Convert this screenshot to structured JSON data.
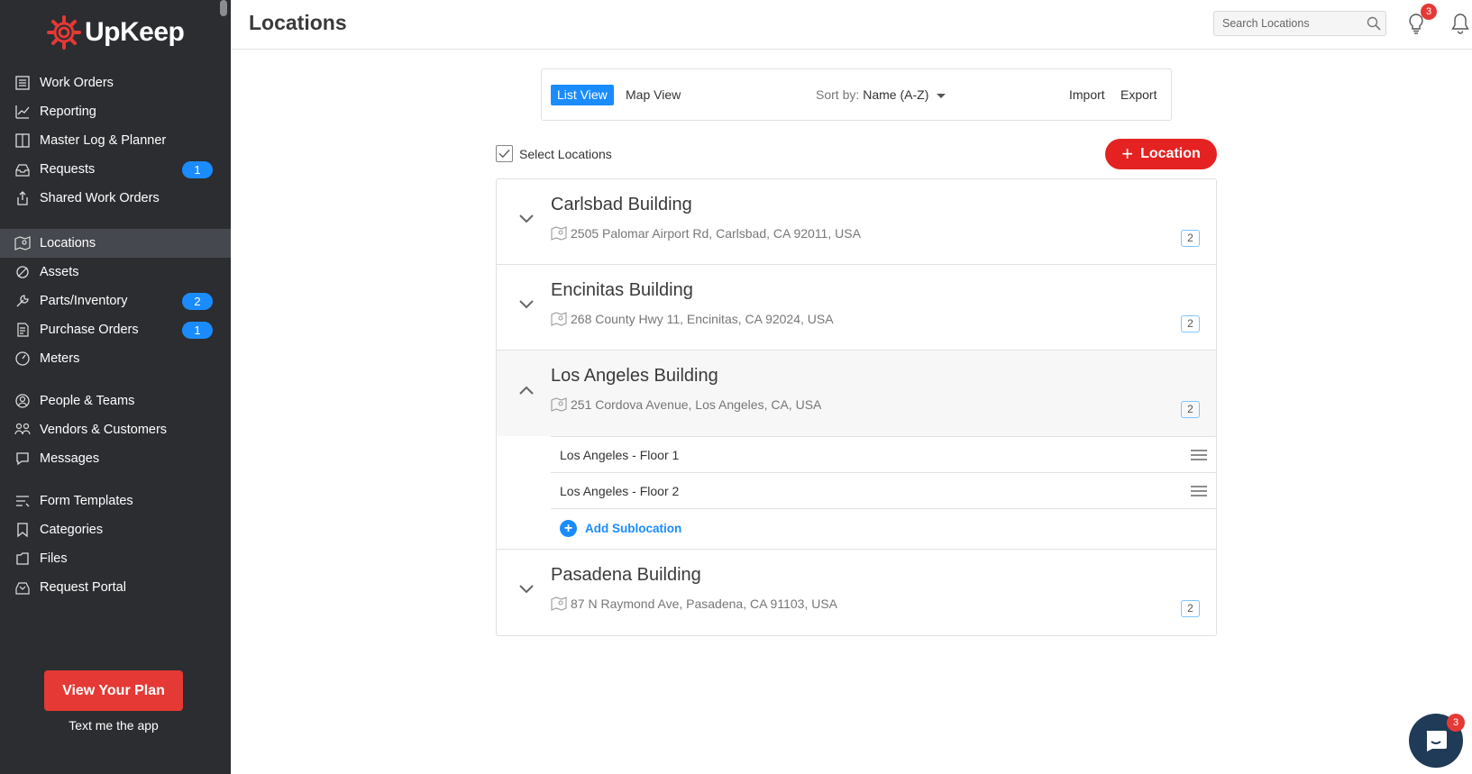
{
  "app": {
    "brand": "UpKeep",
    "accent": "#1a8cff",
    "brand_red": "#e53935"
  },
  "sidebar": {
    "groups": [
      [
        {
          "label": "Work Orders",
          "icon": "list-icon"
        },
        {
          "label": "Reporting",
          "icon": "chart-icon"
        },
        {
          "label": "Master Log & Planner",
          "icon": "book-icon"
        },
        {
          "label": "Requests",
          "icon": "inbox-icon",
          "badge": "1"
        },
        {
          "label": "Shared Work Orders",
          "icon": "share-icon"
        }
      ],
      [
        {
          "label": "Locations",
          "icon": "map-icon",
          "active": true
        },
        {
          "label": "Assets",
          "icon": "asset-icon"
        },
        {
          "label": "Parts/Inventory",
          "icon": "wrench-icon",
          "badge": "2"
        },
        {
          "label": "Purchase Orders",
          "icon": "document-icon",
          "badge": "1"
        },
        {
          "label": "Meters",
          "icon": "gauge-icon"
        }
      ],
      [
        {
          "label": "People & Teams",
          "icon": "people-icon"
        },
        {
          "label": "Vendors & Customers",
          "icon": "vendors-icon"
        },
        {
          "label": "Messages",
          "icon": "chat-bubble-icon"
        }
      ],
      [
        {
          "label": "Form Templates",
          "icon": "form-icon"
        },
        {
          "label": "Categories",
          "icon": "bookmark-icon"
        },
        {
          "label": "Files",
          "icon": "files-icon"
        },
        {
          "label": "Request Portal",
          "icon": "portal-icon"
        }
      ]
    ],
    "plan_button": "View Your Plan",
    "text_app": "Text me the app"
  },
  "header": {
    "title": "Locations",
    "search_placeholder": "Search Locations",
    "ideas_badge": "3",
    "icons": [
      "lightbulb-icon",
      "bell-icon",
      "search-icon"
    ]
  },
  "toolbar": {
    "list_view": "List View",
    "map_view": "Map View",
    "sort_prefix": "Sort by:",
    "sort_value": "Name (A-Z)",
    "import": "Import",
    "export": "Export"
  },
  "select_label": "Select Locations",
  "add_location_label": "Location",
  "locations": [
    {
      "name": "Carlsbad Building",
      "address": "2505 Palomar Airport Rd, Carlsbad, CA 92011, USA",
      "count": "2",
      "expanded": false
    },
    {
      "name": "Encinitas Building",
      "address": "268 County Hwy 11, Encinitas, CA 92024, USA",
      "count": "2",
      "expanded": false
    },
    {
      "name": "Los Angeles Building",
      "address": "251 Cordova Avenue, Los Angeles, CA, USA",
      "count": "2",
      "expanded": true,
      "sublocations": [
        "Los Angeles - Floor 1",
        "Los Angeles - Floor 2"
      ]
    },
    {
      "name": "Pasadena Building",
      "address": "87 N Raymond Ave, Pasadena, CA 91103, USA",
      "count": "2",
      "expanded": false
    }
  ],
  "add_sublocation": "Add Sublocation",
  "chat_badge": "3"
}
